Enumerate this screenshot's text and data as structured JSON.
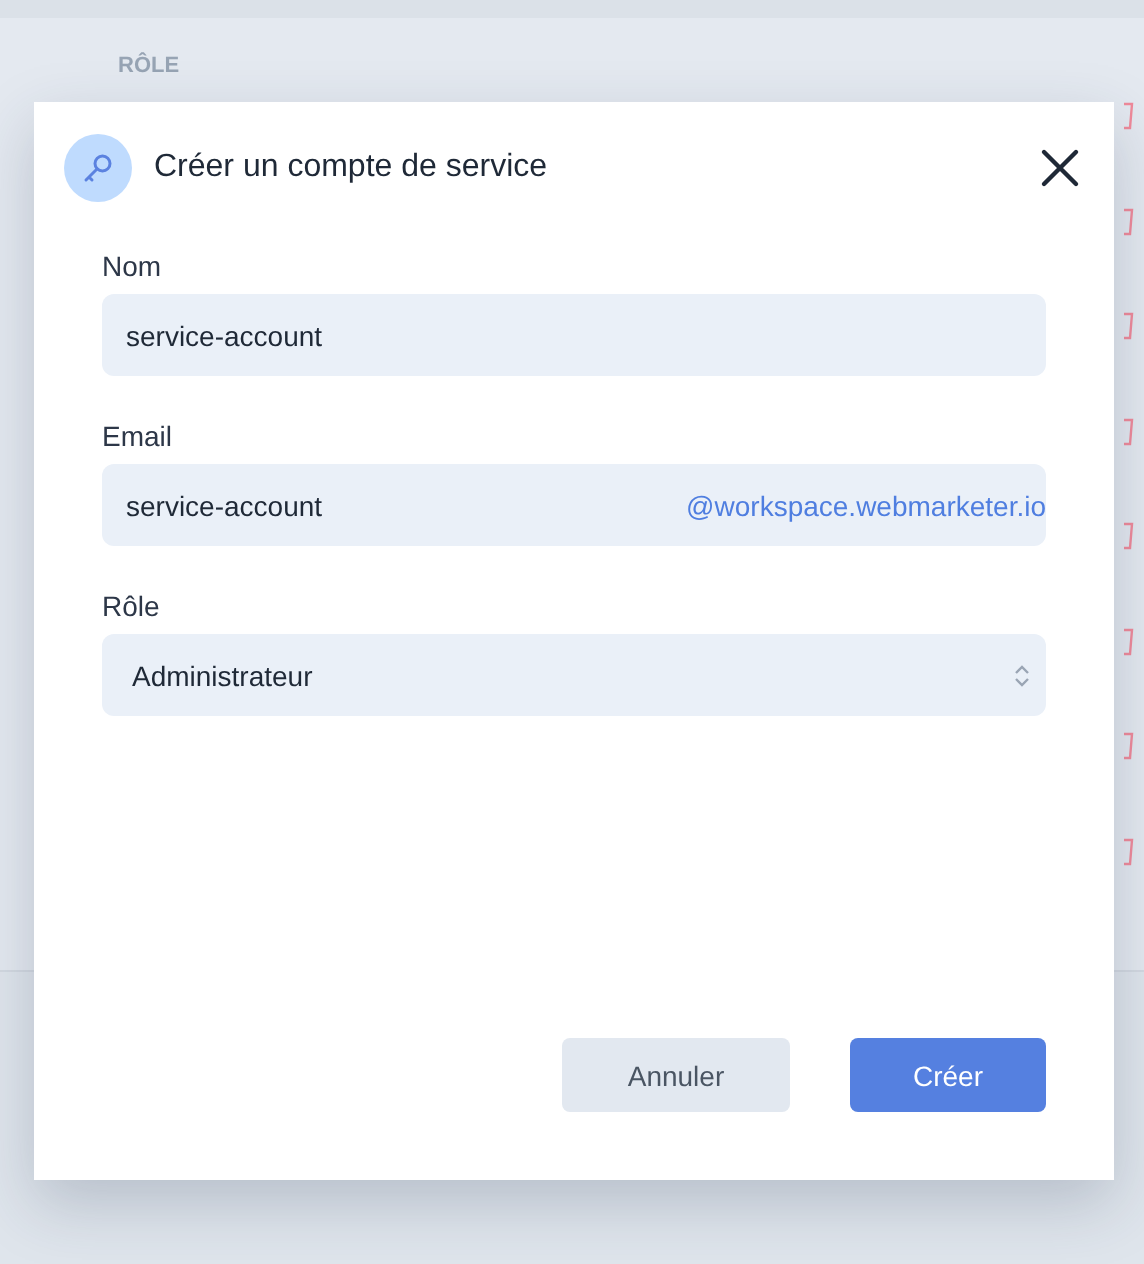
{
  "table": {
    "column_header": "RÔLE"
  },
  "dialog": {
    "title": "Créer un compte de service",
    "fields": [
      {
        "kind": "text",
        "label": "Nom",
        "value": "service-account"
      },
      {
        "kind": "email",
        "label": "Email",
        "value": "service-account",
        "suffix": "@workspace.webmarketer.io"
      },
      {
        "kind": "select",
        "label": "Rôle",
        "value": "Administrateur"
      }
    ],
    "buttons": [
      {
        "kind": "secondary",
        "label": "Annuler"
      },
      {
        "kind": "primary",
        "label": "Créer"
      }
    ]
  }
}
